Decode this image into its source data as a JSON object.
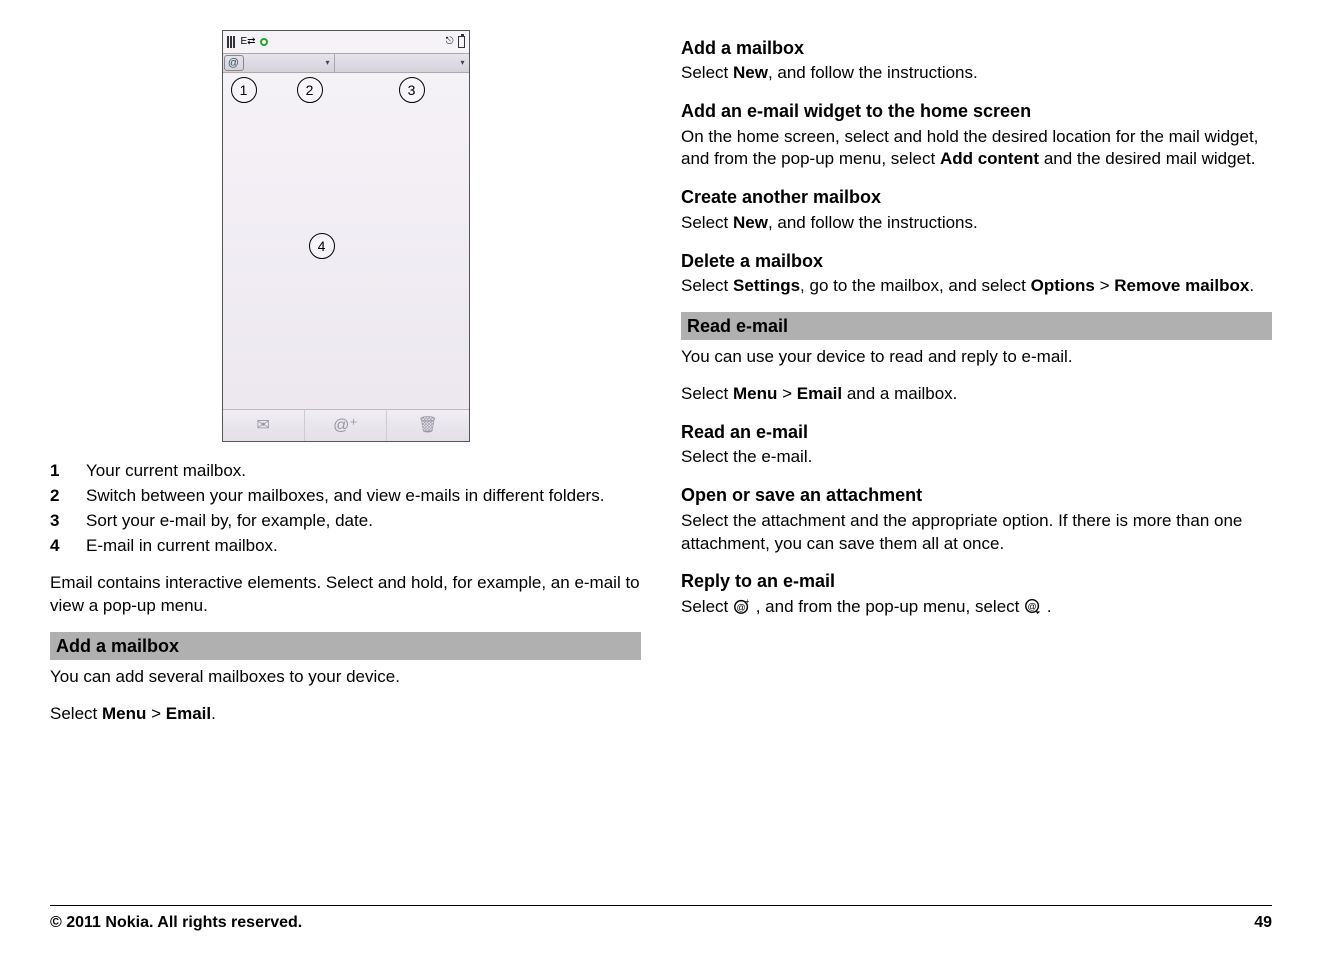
{
  "legend": {
    "items": [
      {
        "num": "1",
        "text": "Your current mailbox."
      },
      {
        "num": "2",
        "text": "Switch between your mailboxes, and view e-mails in different folders."
      },
      {
        "num": "3",
        "text": "Sort your e-mail by, for example, date."
      },
      {
        "num": "4",
        "text": "E-mail in current mailbox."
      }
    ]
  },
  "left": {
    "note": "Email contains interactive elements. Select and hold, for example, an e-mail to view a pop-up menu.",
    "add_mailbox_bar": "Add a mailbox",
    "add_mailbox_text": "You can add several mailboxes to your device.",
    "select_prefix": "Select ",
    "menu": "Menu",
    "gt": " > ",
    "email": "Email",
    "period": "."
  },
  "right": {
    "s1_h": "Add a mailbox",
    "s1_t1": "Select ",
    "s1_b": "New",
    "s1_t2": ", and follow the instructions.",
    "s2_h": "Add an e-mail widget to the home screen",
    "s2_t1": "On the home screen, select and hold the desired location for the mail widget, and from the pop-up menu, select ",
    "s2_b": "Add content",
    "s2_t2": " and the desired mail widget.",
    "s3_h": "Create another mailbox",
    "s3_t1": "Select ",
    "s3_b": "New",
    "s3_t2": ", and follow the instructions.",
    "s4_h": "Delete a mailbox",
    "s4_t1": "Select ",
    "s4_b1": "Settings",
    "s4_t2": ", go to the mailbox, and select ",
    "s4_b2": "Options",
    "s4_gt": " > ",
    "s4_b3": "Remove mailbox",
    "s4_t3": ".",
    "read_bar": "Read e-mail",
    "read_intro": "You can use your device to read and reply to e-mail.",
    "read_sel_t1": "Select ",
    "read_sel_b1": "Menu",
    "read_sel_gt": " > ",
    "read_sel_b2": "Email",
    "read_sel_t2": " and a mailbox.",
    "r1_h": "Read an e-mail",
    "r1_t": "Select the e-mail.",
    "r2_h": "Open or save an attachment",
    "r2_t": "Select the attachment and the appropriate option. If there is more than one attachment, you can save them all at once.",
    "r3_h": "Reply to an e-mail",
    "r3_t1": "Select ",
    "r3_t2": ", and from the pop-up menu, select ",
    "r3_t3": "."
  },
  "footer": {
    "copyright": "© 2011 Nokia. All rights reserved.",
    "page": "49"
  },
  "callouts": {
    "c1": "1",
    "c2": "2",
    "c3": "3",
    "c4": "4"
  }
}
